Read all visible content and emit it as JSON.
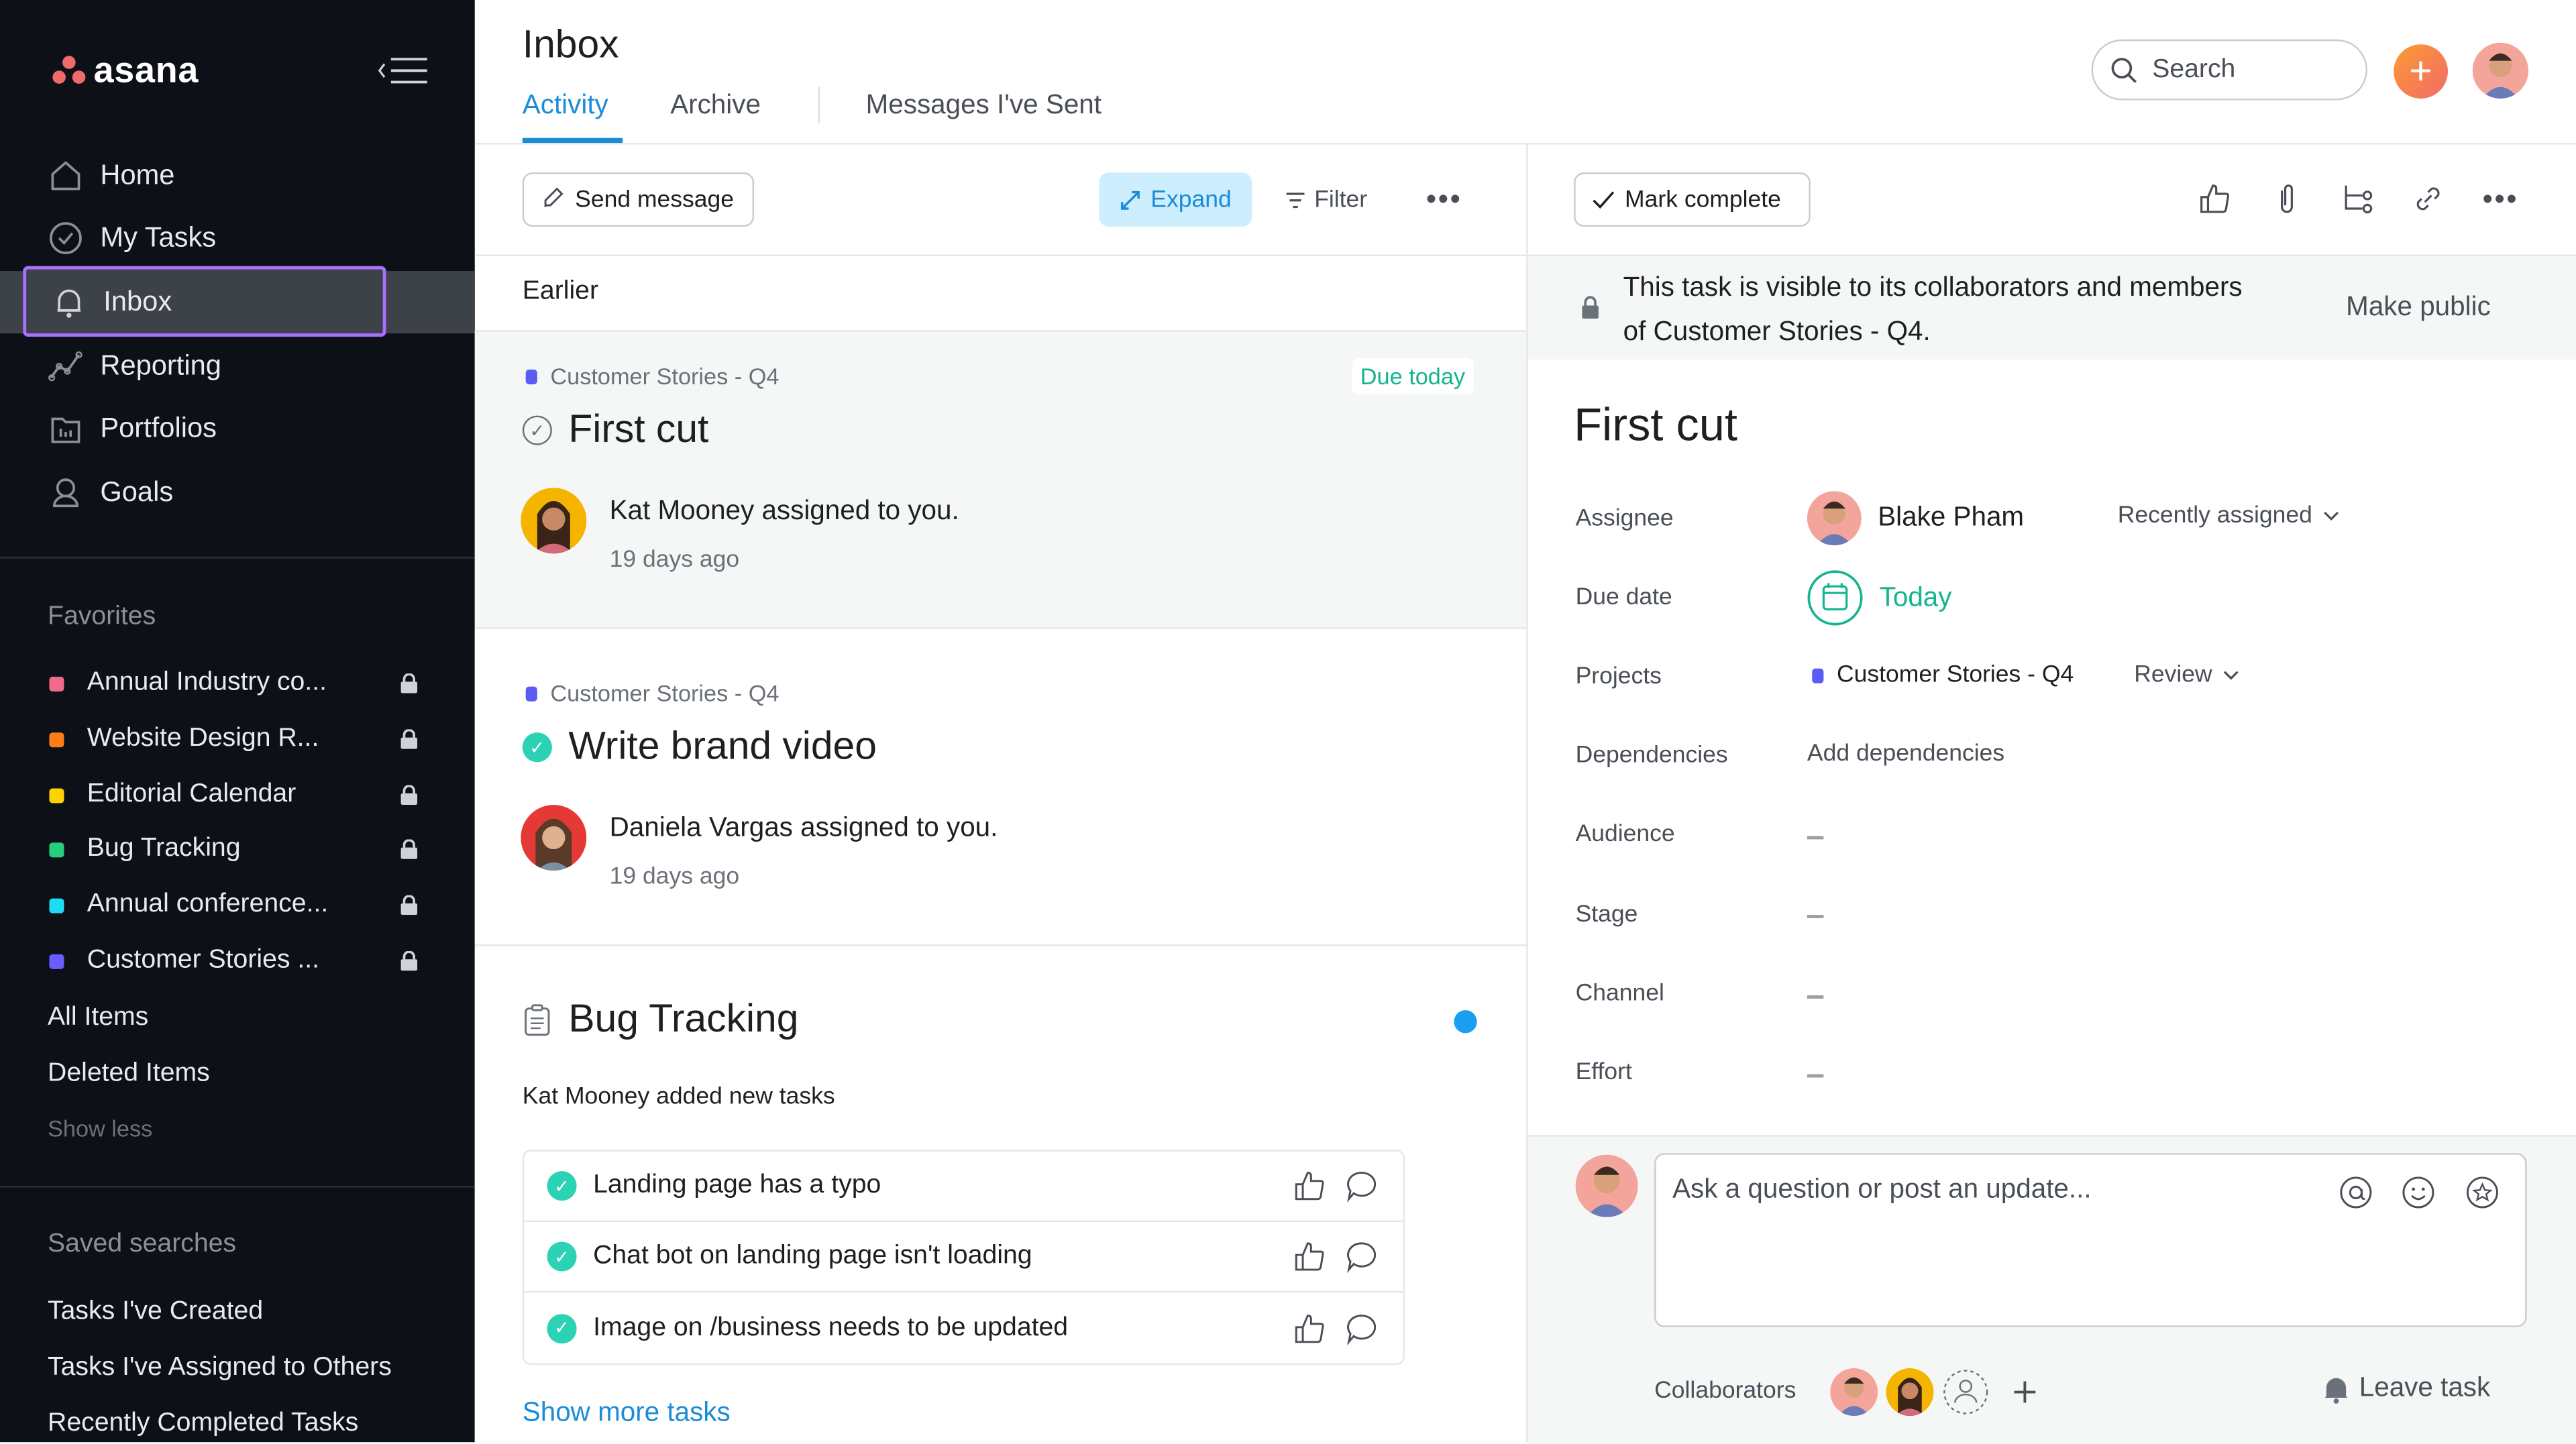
{
  "app": {
    "name": "asana"
  },
  "sidebar": {
    "nav": [
      {
        "label": "Home",
        "icon": "home-icon"
      },
      {
        "label": "My Tasks",
        "icon": "check-circle-icon"
      },
      {
        "label": "Inbox",
        "icon": "bell-icon",
        "active": true
      },
      {
        "label": "Reporting",
        "icon": "reporting-icon"
      },
      {
        "label": "Portfolios",
        "icon": "portfolio-icon"
      },
      {
        "label": "Goals",
        "icon": "goals-icon"
      }
    ],
    "favorites_label": "Favorites",
    "favorites": [
      {
        "label": "Annual Industry co...",
        "color": "#f06a8a",
        "locked": true
      },
      {
        "label": "Website Design R...",
        "color": "#fd7e14",
        "locked": true
      },
      {
        "label": "Editorial Calendar",
        "color": "#ffd100",
        "locked": true
      },
      {
        "label": "Bug Tracking",
        "color": "#25d07c",
        "locked": true
      },
      {
        "label": "Annual conference...",
        "color": "#1ddcf2",
        "locked": true
      },
      {
        "label": "Customer Stories ...",
        "color": "#6b5cff",
        "locked": true
      }
    ],
    "all_items": "All Items",
    "deleted_items": "Deleted Items",
    "show_less": "Show less",
    "saved_searches_label": "Saved searches",
    "saved_searches": [
      "Tasks I've Created",
      "Tasks I've Assigned to Others",
      "Recently Completed Tasks"
    ]
  },
  "header": {
    "title": "Inbox",
    "tabs": [
      {
        "label": "Activity",
        "active": true
      },
      {
        "label": "Archive"
      },
      {
        "label": "Messages I've Sent"
      }
    ],
    "search_placeholder": "Search",
    "add_label": "+"
  },
  "inbox": {
    "toolbar": {
      "send_message": "Send message",
      "expand": "Expand",
      "filter": "Filter",
      "more": "•••"
    },
    "section_label": "Earlier",
    "items": [
      {
        "project": "Customer Stories - Q4",
        "badge": "Due today",
        "title": "First cut",
        "completed": false,
        "story": "Kat Mooney assigned to you.",
        "time": "19 days ago"
      },
      {
        "project": "Customer Stories - Q4",
        "title": "Write brand video",
        "completed": true,
        "story": "Daniela Vargas assigned to you.",
        "time": "19 days ago"
      }
    ],
    "project_update": {
      "title": "Bug Tracking",
      "summary": "Kat Mooney added new tasks",
      "tasks": [
        "Landing page has a typo",
        "Chat bot on landing page isn't loading",
        "Image on /business needs to be updated"
      ],
      "show_more": "Show more tasks"
    }
  },
  "task": {
    "mark_complete": "Mark complete",
    "privacy_line1": "This task is visible to its collaborators and members",
    "privacy_line2": "of Customer Stories - Q4.",
    "make_public": "Make public",
    "title": "First cut",
    "fields": {
      "assignee_label": "Assignee",
      "assignee": "Blake Pham",
      "assignee_section": "Recently assigned",
      "due_label": "Due date",
      "due": "Today",
      "projects_label": "Projects",
      "project": "Customer Stories - Q4",
      "project_section": "Review",
      "dependencies_label": "Dependencies",
      "dependencies": "Add dependencies",
      "audience_label": "Audience",
      "stage_label": "Stage",
      "channel_label": "Channel",
      "effort_label": "Effort"
    },
    "comment_placeholder": "Ask a question or post an update...",
    "collaborators_label": "Collaborators",
    "leave_task": "Leave task"
  },
  "colors": {
    "accent": "#1a8cd8",
    "success": "#13b58e",
    "sidebar_bg": "#0d1117",
    "active_outline": "#a970ff"
  }
}
